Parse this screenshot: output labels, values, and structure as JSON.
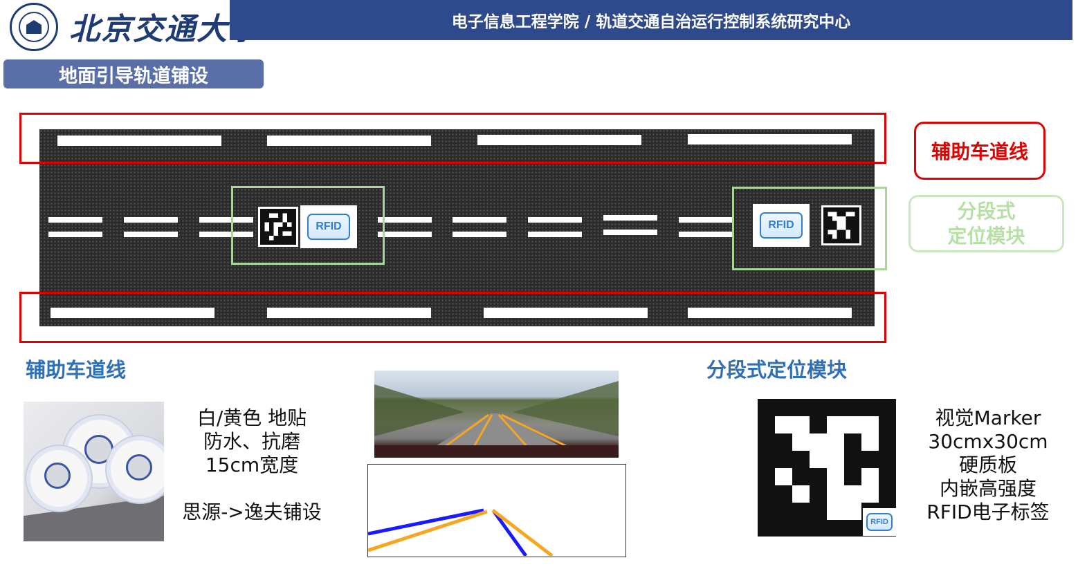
{
  "header": {
    "university_name": "北京交通大學",
    "title": "电子信息工程学院 / 轨道交通自治运行控制系统研究中心"
  },
  "section": {
    "title": "地面引导轨道铺设"
  },
  "legend": {
    "lane_label": "辅助车道线",
    "module_line1": "分段式",
    "module_line2": "定位模块"
  },
  "road": {
    "rfid_label": "RFID"
  },
  "tape": {
    "heading": "辅助车道线",
    "lines": [
      "白/黄色 地贴",
      "防水、抗磨",
      "15cm宽度",
      "",
      "思源->逸夫铺设"
    ]
  },
  "module": {
    "heading": "分段式定位模块",
    "lines": [
      "视觉Marker",
      "30cmx30cm",
      "硬质板",
      "内嵌高强度",
      "RFID电子标签"
    ],
    "rfid_label": "RFID"
  },
  "colors": {
    "header_bg": "#2f4a8c",
    "lane_box": "#e10000",
    "module_box": "#a9d79a",
    "heading_blue": "#2f6fb5",
    "detected_line": "#f5a623",
    "fitted_line": "#1a1aff"
  }
}
